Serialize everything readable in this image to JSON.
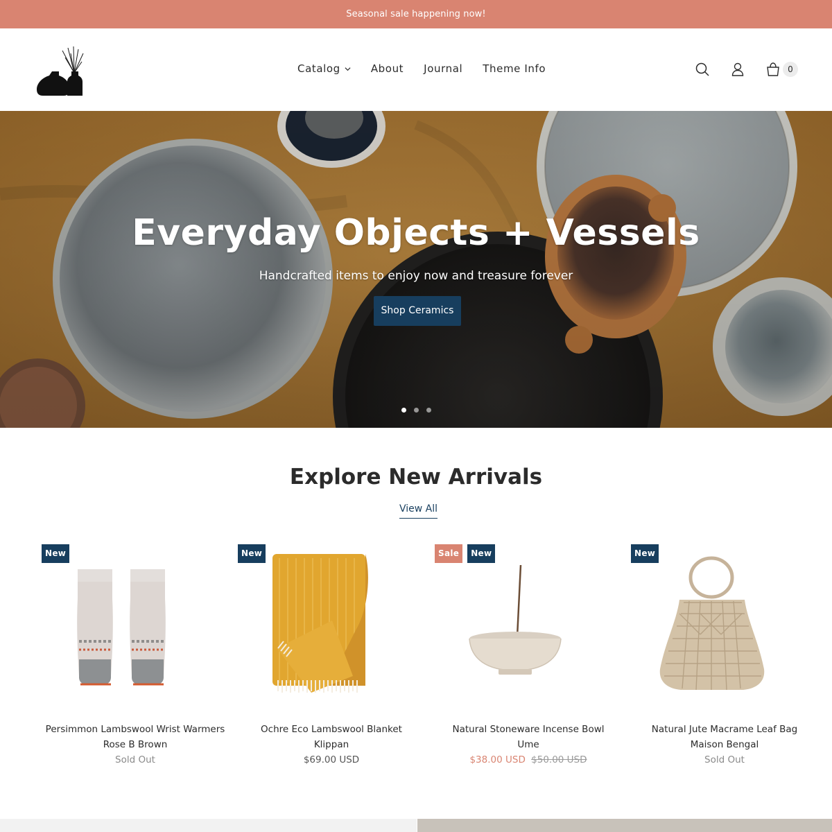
{
  "announcement": "Seasonal sale happening now!",
  "nav": {
    "items": [
      {
        "label": "Catalog"
      },
      {
        "label": "About"
      },
      {
        "label": "Journal"
      },
      {
        "label": "Theme Info"
      }
    ]
  },
  "header": {
    "cart_count": "0",
    "icons": [
      "search-icon",
      "account-icon",
      "cart-icon"
    ]
  },
  "hero": {
    "title": "Everyday Objects + Vessels",
    "subtitle": "Handcrafted items to enjoy now and treasure forever",
    "button": "Shop Ceramics",
    "slides": 3,
    "active_slide": 1
  },
  "arrivals": {
    "title": "Explore New Arrivals",
    "view_all": "View All",
    "products": [
      {
        "badges": [
          "New"
        ],
        "name": "Persimmon Lambswool Wrist Warmers",
        "vendor": "Rose B Brown",
        "price": "Sold Out"
      },
      {
        "badges": [
          "New"
        ],
        "name": "Ochre Eco Lambswool Blanket",
        "vendor": "Klippan",
        "price": "$69.00 USD"
      },
      {
        "badges": [
          "Sale",
          "New"
        ],
        "name": "Natural Stoneware Incense Bowl",
        "vendor": "Ume",
        "sale_price": "$38.00 USD",
        "original_price": "$50.00 USD"
      },
      {
        "badges": [
          "New"
        ],
        "name": "Natural Jute Macrame Leaf Bag",
        "vendor": "Maison Bengal",
        "price": "Sold Out"
      }
    ]
  },
  "colors": {
    "announcement_bg": "#d98471",
    "accent": "#173e5e",
    "sale": "#d98471"
  }
}
